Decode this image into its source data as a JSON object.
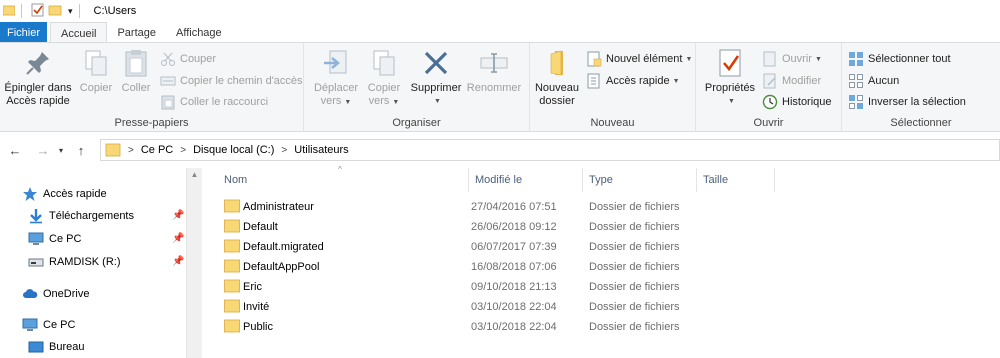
{
  "title_bar": {
    "path": "C:\\Users"
  },
  "tabs": [
    {
      "label": "Fichier"
    },
    {
      "label": "Accueil"
    },
    {
      "label": "Partage"
    },
    {
      "label": "Affichage"
    }
  ],
  "ribbon": {
    "clipboard": {
      "pin_label_1": "Épingler dans",
      "pin_label_2": "Accès rapide",
      "copy_label": "Copier",
      "paste_label": "Coller",
      "cut_label": "Couper",
      "copy_path_label": "Copier le chemin d'accès",
      "paste_shortcut_label": "Coller le raccourci",
      "group_label": "Presse-papiers"
    },
    "organize": {
      "move_label_1": "Déplacer",
      "move_label_2": "vers",
      "copy_to_label_1": "Copier",
      "copy_to_label_2": "vers",
      "delete_label": "Supprimer",
      "rename_label": "Renommer",
      "group_label": "Organiser"
    },
    "new": {
      "new_folder_label_1": "Nouveau",
      "new_folder_label_2": "dossier",
      "new_item_label": "Nouvel élément",
      "quick_access_label": "Accès rapide",
      "group_label": "Nouveau"
    },
    "open": {
      "properties_label": "Propriétés",
      "open_label": "Ouvrir",
      "edit_label": "Modifier",
      "history_label": "Historique",
      "group_label": "Ouvrir"
    },
    "select": {
      "select_all_label": "Sélectionner tout",
      "select_none_label": "Aucun",
      "invert_label": "Inverser la sélection",
      "group_label": "Sélectionner"
    }
  },
  "address": {
    "crumbs": [
      "Ce PC",
      "Disque local (C:)",
      "Utilisateurs"
    ]
  },
  "nav_pane": {
    "items": [
      {
        "label": "Accès rapide"
      },
      {
        "label": "Téléchargements"
      },
      {
        "label": "Ce PC"
      },
      {
        "label": "RAMDISK (R:)"
      },
      {
        "label": "OneDrive"
      },
      {
        "label": "Ce PC"
      },
      {
        "label": "Bureau"
      }
    ]
  },
  "file_list": {
    "columns": {
      "name": "Nom",
      "modified": "Modifié le",
      "type": "Type",
      "size": "Taille"
    },
    "rows": [
      {
        "name": "Administrateur",
        "modified": "27/04/2016 07:51",
        "type": "Dossier de fichiers"
      },
      {
        "name": "Default",
        "modified": "26/06/2018 09:12",
        "type": "Dossier de fichiers"
      },
      {
        "name": "Default.migrated",
        "modified": "06/07/2017 07:39",
        "type": "Dossier de fichiers"
      },
      {
        "name": "DefaultAppPool",
        "modified": "16/08/2018 07:06",
        "type": "Dossier de fichiers"
      },
      {
        "name": "Eric",
        "modified": "09/10/2018 21:13",
        "type": "Dossier de fichiers"
      },
      {
        "name": "Invité",
        "modified": "03/10/2018 22:04",
        "type": "Dossier de fichiers"
      },
      {
        "name": "Public",
        "modified": "03/10/2018 22:04",
        "type": "Dossier de fichiers"
      }
    ]
  },
  "colors": {
    "file_tab": "#1979ca",
    "folder": "#f8d775",
    "ribbon_bg": "#f5f6f7",
    "header_text": "#4c607a"
  }
}
